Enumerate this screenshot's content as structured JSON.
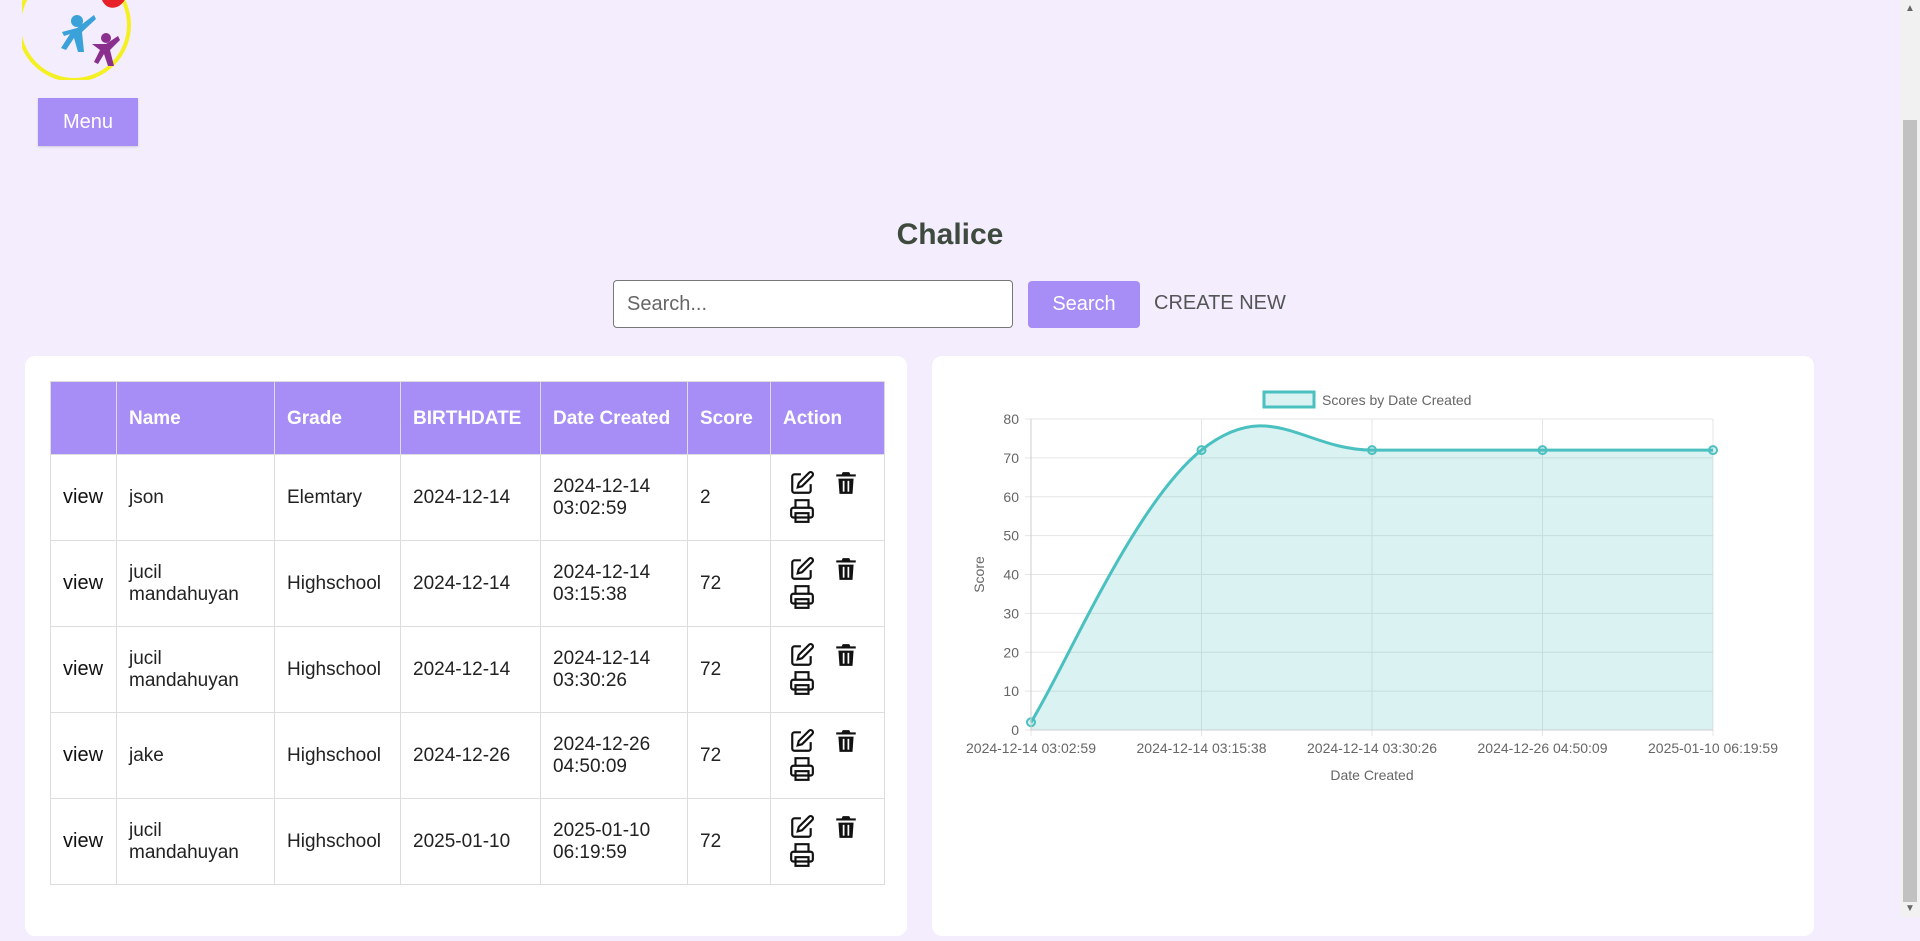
{
  "header": {
    "menu_label": "Menu",
    "logo_icon": "family-logo-icon"
  },
  "page_title": "Chalice",
  "search": {
    "placeholder": "Search...",
    "value": "",
    "button_label": "Search",
    "create_label": "CREATE NEW"
  },
  "table": {
    "columns": [
      "",
      "Name",
      "Grade",
      "BIRTHDATE",
      "Date Created",
      "Score",
      "Action"
    ],
    "rows": [
      {
        "view": "view",
        "name": "json",
        "grade": "Elemtary",
        "birthdate": "2024-12-14",
        "date_created": "2024-12-14 03:02:59",
        "score": "2"
      },
      {
        "view": "view",
        "name": "jucil mandahuyan",
        "grade": "Highschool",
        "birthdate": "2024-12-14",
        "date_created": "2024-12-14 03:15:38",
        "score": "72"
      },
      {
        "view": "view",
        "name": "jucil mandahuyan",
        "grade": "Highschool",
        "birthdate": "2024-12-14",
        "date_created": "2024-12-14 03:30:26",
        "score": "72"
      },
      {
        "view": "view",
        "name": "jake",
        "grade": "Highschool",
        "birthdate": "2024-12-26",
        "date_created": "2024-12-26 04:50:09",
        "score": "72"
      },
      {
        "view": "view",
        "name": "jucil mandahuyan",
        "grade": "Highschool",
        "birthdate": "2025-01-10",
        "date_created": "2025-01-10 06:19:59",
        "score": "72"
      }
    ],
    "action_icons": [
      "edit-icon",
      "trash-icon",
      "print-icon"
    ]
  },
  "chart_data": {
    "type": "area",
    "categories": [
      "2024-12-14 03:02:59",
      "2024-12-14 03:15:38",
      "2024-12-14 03:30:26",
      "2024-12-26 04:50:09",
      "2025-01-10 06:19:59"
    ],
    "series": [
      {
        "name": "Scores by Date Created",
        "values": [
          2,
          72,
          72,
          72,
          72
        ]
      }
    ],
    "xlabel": "Date Created",
    "ylabel": "Score",
    "ylim": [
      0,
      80
    ],
    "yticks": [
      0,
      10,
      20,
      30,
      40,
      50,
      60,
      70,
      80
    ],
    "grid": true,
    "legend": "top-center",
    "colors": {
      "line": "#4bc0c0",
      "fill": "rgba(75,192,192,0.2)"
    }
  },
  "colors": {
    "accent": "#a78df6",
    "background": "#f3edfe"
  }
}
